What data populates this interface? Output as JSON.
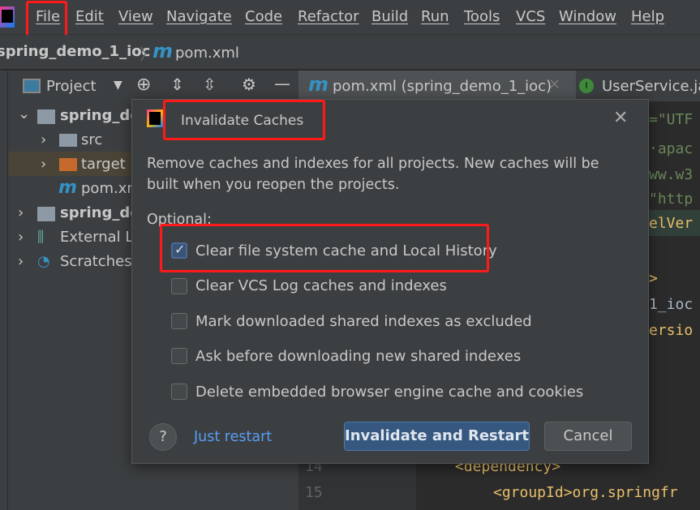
{
  "menubar": {
    "items": [
      "File",
      "Edit",
      "View",
      "Navigate",
      "Code",
      "Refactor",
      "Build",
      "Run",
      "Tools",
      "VCS",
      "Window",
      "Help"
    ]
  },
  "breadcrumb": {
    "project": "spring_demo_1_ioc",
    "file": "pom.xml"
  },
  "project_panel": {
    "title": "Project",
    "tree": [
      {
        "label": "spring_de",
        "bold": true
      },
      {
        "label": "src"
      },
      {
        "label": "target"
      },
      {
        "label": "pom.xm"
      },
      {
        "label": "spring_de",
        "bold": true
      },
      {
        "label": "External Li"
      },
      {
        "label": "Scratches a"
      }
    ]
  },
  "editor": {
    "tabs": [
      {
        "label": "pom.xml (spring_demo_1_ioc)",
        "active": true
      },
      {
        "label": "UserService.jav"
      }
    ],
    "code_fragments": [
      "=\"UTF",
      "·apac",
      "ww.w3",
      "\"http",
      "elVer",
      ">",
      "1_ioc",
      "ersio"
    ],
    "line_numbers": [
      "14",
      "15"
    ],
    "lines": [
      "<dependency>",
      "<groupId>org.springfr"
    ]
  },
  "dialog": {
    "title": "Invalidate Caches",
    "description": "Remove caches and indexes for all projects. New caches will be built when you reopen the projects.",
    "optional_label": "Optional:",
    "options": [
      {
        "label": "Clear file system cache and Local History",
        "checked": true
      },
      {
        "label": "Clear VCS Log caches and indexes",
        "checked": false
      },
      {
        "label": "Mark downloaded shared indexes as excluded",
        "checked": false
      },
      {
        "label": "Ask before downloading new shared indexes",
        "checked": false
      },
      {
        "label": "Delete embedded browser engine cache and cookies",
        "checked": false
      }
    ],
    "help": "?",
    "just_restart": "Just restart",
    "primary": "Invalidate and Restart",
    "cancel": "Cancel"
  },
  "colors": {
    "highlight": "#ff1a1a",
    "primary": "#365880",
    "link": "#589df6"
  }
}
